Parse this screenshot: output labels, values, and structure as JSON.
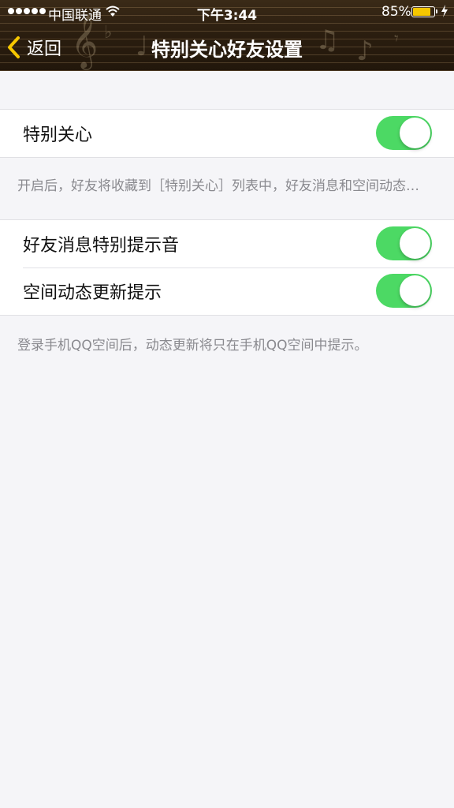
{
  "status_bar": {
    "carrier": "中国联通",
    "time": "下午3:44",
    "battery_percent": "85%",
    "battery_level": 0.85,
    "battery_color": "#f6c700"
  },
  "nav": {
    "back_label": "返回",
    "title": "特别关心好友设置",
    "accent_color": "#f6c700"
  },
  "section1": {
    "items": [
      {
        "label": "特别关心",
        "enabled": true
      }
    ],
    "footnote": "开启后，好友将收藏到［特别关心］列表中，好友消息和空间动态…"
  },
  "section2": {
    "items": [
      {
        "label": "好友消息特别提示音",
        "enabled": true
      },
      {
        "label": "空间动态更新提示",
        "enabled": true
      }
    ],
    "footnote": "登录手机QQ空间后，动态更新将只在手机QQ空间中提示。"
  },
  "colors": {
    "switch_on": "#4cd964",
    "background": "#f5f5f8"
  }
}
